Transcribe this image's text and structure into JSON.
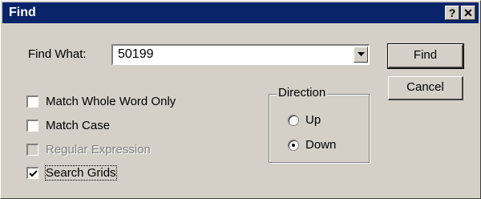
{
  "window": {
    "title": "Find",
    "help_label": "?",
    "close_label": "✕"
  },
  "find_what": {
    "label": "Find What:",
    "value": "50199"
  },
  "buttons": {
    "find": "Find",
    "cancel": "Cancel"
  },
  "options": [
    {
      "label": "Match Whole Word Only",
      "checked": false,
      "enabled": true
    },
    {
      "label": "Match Case",
      "checked": false,
      "enabled": true
    },
    {
      "label": "Regular Expression",
      "checked": false,
      "enabled": false
    },
    {
      "label": "Search Grids",
      "checked": true,
      "enabled": true
    }
  ],
  "direction": {
    "label": "Direction",
    "options": [
      {
        "label": "Up",
        "selected": false
      },
      {
        "label": "Down",
        "selected": true
      }
    ]
  },
  "icons": {
    "dropdown": "chevron-down-icon",
    "check": "checkmark-icon",
    "radio_dot": "radio-dot-icon"
  },
  "colors": {
    "titlebar": "#0a246a",
    "face": "#d4d0c8"
  }
}
